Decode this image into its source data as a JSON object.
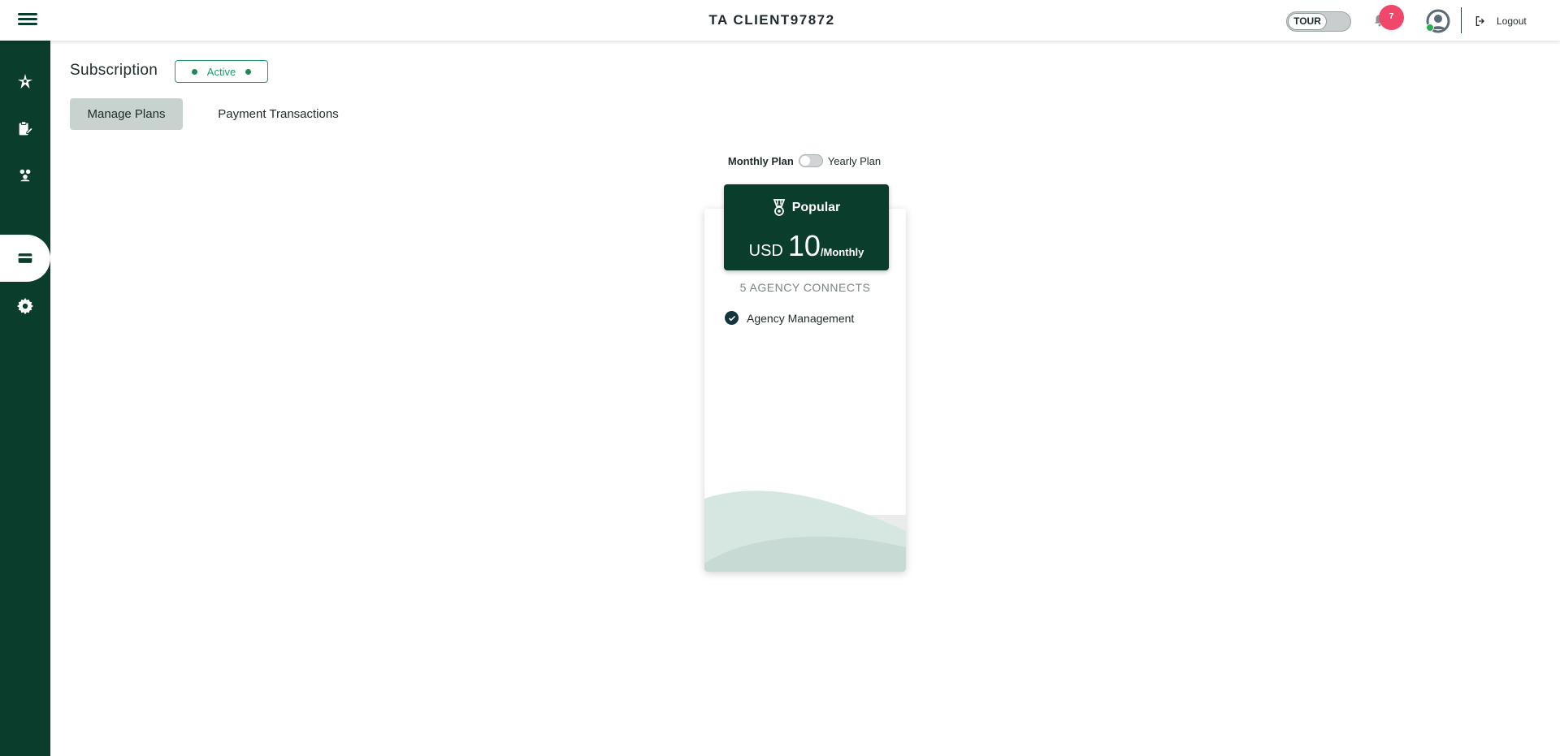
{
  "header": {
    "title": "TA CLIENT97872",
    "tour_label": "TOUR",
    "notification_count": "7",
    "logout_label": "Logout"
  },
  "sidebar": {
    "items": [
      {
        "icon": "compass-rose-icon"
      },
      {
        "icon": "clipboard-edit-icon"
      },
      {
        "icon": "users-group-icon"
      },
      {
        "icon": "credit-card-icon",
        "active": true
      },
      {
        "icon": "gear-icon"
      }
    ]
  },
  "page": {
    "title": "Subscription",
    "status": "Active"
  },
  "tabs": [
    {
      "label": "Manage Plans",
      "active": true
    },
    {
      "label": "Payment Transactions",
      "active": false
    }
  ],
  "plan_toggle": {
    "monthly_label": "Monthly Plan",
    "yearly_label": "Yearly Plan"
  },
  "plan_card": {
    "badge": "Popular",
    "currency": "USD",
    "amount": "10",
    "period": "/Monthly",
    "connects": "5 AGENCY CONNECTS",
    "features": [
      "Agency Management"
    ]
  },
  "colors": {
    "brand_dark_green": "#0b3d2c",
    "active_green": "#1f9c66",
    "badge_pink": "#f0476b",
    "tab_active_bg": "#c8d3d0"
  }
}
